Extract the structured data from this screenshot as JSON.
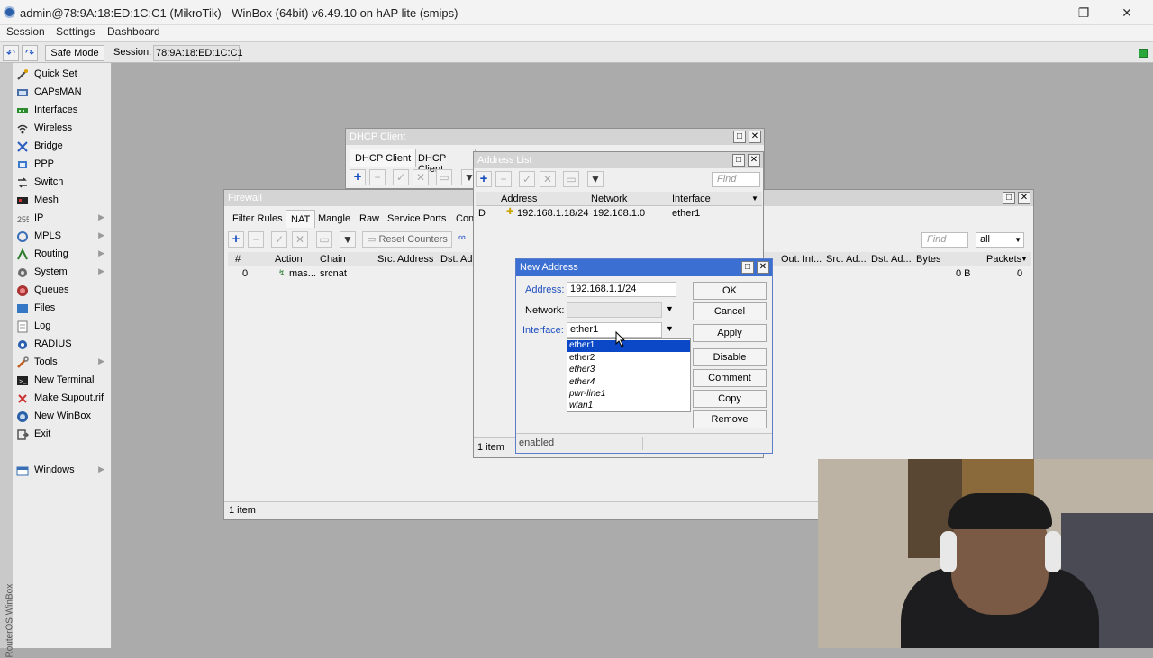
{
  "window": {
    "title": "admin@78:9A:18:ED:1C:C1 (MikroTik) - WinBox (64bit) v6.49.10 on hAP lite (smips)",
    "minimize": "—",
    "maximize": "❐",
    "close": "✕"
  },
  "menubar": [
    "Session",
    "Settings",
    "Dashboard"
  ],
  "toolbar": {
    "undo": "↶",
    "redo": "↷",
    "safe_mode": "Safe Mode",
    "session_label": "Session:",
    "session_value": "78:9A:18:ED:1C:C1"
  },
  "sidebar": {
    "brand": "RouterOS WinBox",
    "items": [
      {
        "label": "Quick Set",
        "icon": "wand-icon",
        "arrow": false
      },
      {
        "label": "CAPsMAN",
        "icon": "capsman-icon",
        "arrow": false
      },
      {
        "label": "Interfaces",
        "icon": "interfaces-icon",
        "arrow": false
      },
      {
        "label": "Wireless",
        "icon": "wireless-icon",
        "arrow": false
      },
      {
        "label": "Bridge",
        "icon": "bridge-icon",
        "arrow": false
      },
      {
        "label": "PPP",
        "icon": "ppp-icon",
        "arrow": false
      },
      {
        "label": "Switch",
        "icon": "switch-icon",
        "arrow": false
      },
      {
        "label": "Mesh",
        "icon": "mesh-icon",
        "arrow": false
      },
      {
        "label": "IP",
        "icon": "ip-icon",
        "arrow": true
      },
      {
        "label": "MPLS",
        "icon": "mpls-icon",
        "arrow": true
      },
      {
        "label": "Routing",
        "icon": "routing-icon",
        "arrow": true
      },
      {
        "label": "System",
        "icon": "system-icon",
        "arrow": true
      },
      {
        "label": "Queues",
        "icon": "queues-icon",
        "arrow": false
      },
      {
        "label": "Files",
        "icon": "files-icon",
        "arrow": false
      },
      {
        "label": "Log",
        "icon": "log-icon",
        "arrow": false
      },
      {
        "label": "RADIUS",
        "icon": "radius-icon",
        "arrow": false
      },
      {
        "label": "Tools",
        "icon": "tools-icon",
        "arrow": true
      },
      {
        "label": "New Terminal",
        "icon": "terminal-icon",
        "arrow": false
      },
      {
        "label": "Make Supout.rif",
        "icon": "supout-icon",
        "arrow": false
      },
      {
        "label": "New WinBox",
        "icon": "winbox-icon",
        "arrow": false
      },
      {
        "label": "Exit",
        "icon": "exit-icon",
        "arrow": false
      },
      {
        "label": "Windows",
        "icon": "windows-icon",
        "arrow": true
      }
    ]
  },
  "firewall": {
    "title": "Firewall",
    "tabs": [
      "Filter Rules",
      "NAT",
      "Mangle",
      "Raw",
      "Service Ports",
      "Conn"
    ],
    "reset_counters": "Reset Counters",
    "find_placeholder": "Find",
    "filter_value": "all",
    "columns": [
      "#",
      "Action",
      "Chain",
      "Src. Address",
      "Dst. Ad",
      "Out. Int...",
      "Src. Ad...",
      "Dst. Ad...",
      "Bytes",
      "Packets"
    ],
    "row": {
      "num": "0",
      "action": "mas...",
      "chain": "srcnat",
      "bytes": "0 B",
      "packets": "0"
    },
    "status": "1 item"
  },
  "dhcp_client": {
    "title": "DHCP Client",
    "tabs": [
      "DHCP Client",
      "DHCP Client"
    ]
  },
  "address_list": {
    "title": "Address List",
    "find_placeholder": "Find",
    "columns": [
      "Address",
      "Network",
      "Interface"
    ],
    "row": {
      "flag": "D",
      "address": "192.168.1.18/24",
      "network": "192.168.1.0",
      "interface": "ether1"
    },
    "status": "1 item"
  },
  "new_address": {
    "title": "New Address",
    "address_label": "Address:",
    "address_value": "192.168.1.1/24",
    "network_label": "Network:",
    "network_value": "",
    "interface_label": "Interface:",
    "interface_value": "ether1",
    "options": [
      "ether1",
      "ether2",
      "ether3",
      "ether4",
      "pwr-line1",
      "wlan1"
    ],
    "buttons": [
      "OK",
      "Cancel",
      "Apply",
      "Disable",
      "Comment",
      "Copy",
      "Remove"
    ],
    "status": "enabled"
  },
  "colors": {
    "accent": "#1f4fbf",
    "selection": "#0a48c8",
    "active_title": "#3b6fd1"
  }
}
